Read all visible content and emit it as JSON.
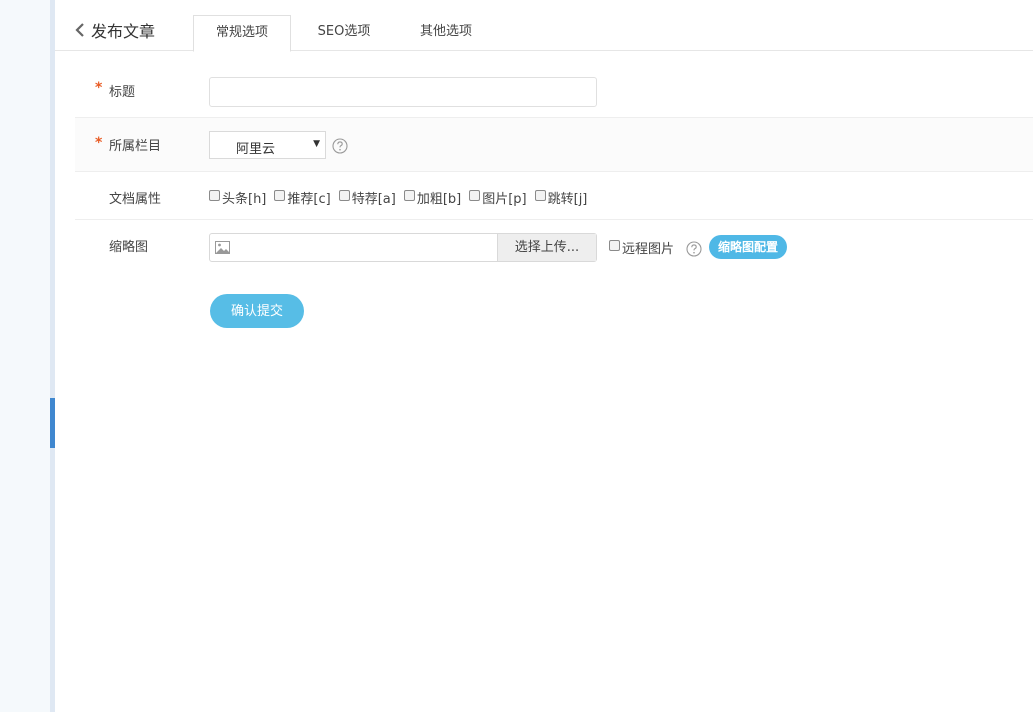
{
  "header": {
    "back_icon": "chevron-left-icon",
    "page_title": "发布文章",
    "tabs": [
      {
        "label": "常规选项",
        "active": true
      },
      {
        "label": "SEO选项",
        "active": false
      },
      {
        "label": "其他选项",
        "active": false
      }
    ]
  },
  "form": {
    "title": {
      "label": "标题",
      "required_mark": "*",
      "value": ""
    },
    "category": {
      "label": "所属栏目",
      "required_mark": "*",
      "selected": "阿里云",
      "help_icon": "question-circle-icon"
    },
    "attributes": {
      "label": "文档属性",
      "options": [
        "头条[h]",
        "推荐[c]",
        "特荐[a]",
        "加粗[b]",
        "图片[p]",
        "跳转[j]"
      ]
    },
    "thumbnail": {
      "label": "缩略图",
      "image_icon": "image-icon",
      "upload_label": "选择上传...",
      "remote_label": "远程图片",
      "help_icon": "question-circle-icon",
      "config_label": "缩略图配置"
    },
    "submit_label": "确认提交"
  },
  "colors": {
    "accent": "#57bde6",
    "required": "#e85b24",
    "sidebar_active": "#3f87cf"
  }
}
